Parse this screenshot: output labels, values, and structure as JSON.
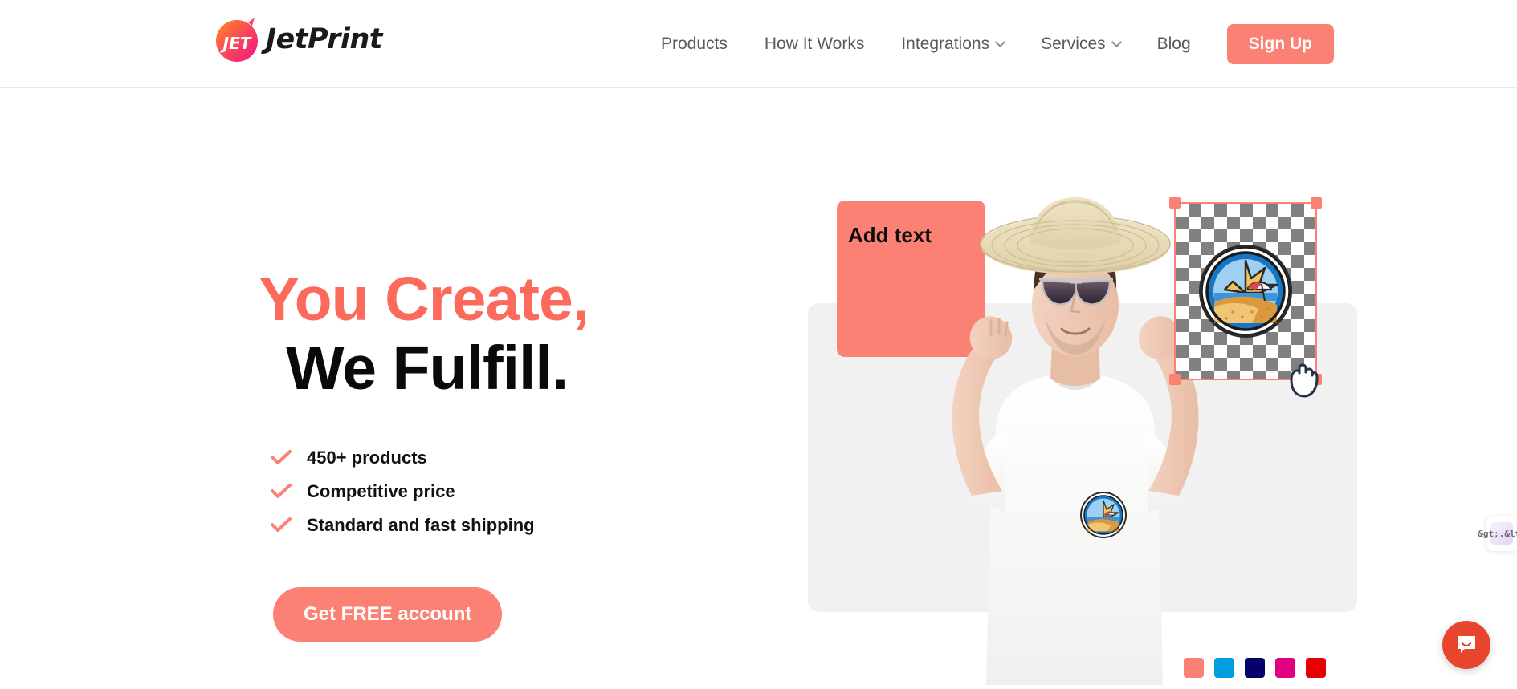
{
  "colors": {
    "accent": "#fb8175",
    "headline_accent": "#fc6a5c",
    "nav_text": "#5a5a5a",
    "panel_bg": "#f1f1f1",
    "intercom": "#e8452f"
  },
  "header": {
    "logo": {
      "mark_text": "JET",
      "wordmark": "JetPrint",
      "icon": "jetprint-logo-icon",
      "gradient_from": "#ff7a2f",
      "gradient_to": "#f0138c"
    },
    "nav": [
      {
        "label": "Products",
        "has_dropdown": false
      },
      {
        "label": "How It Works",
        "has_dropdown": false
      },
      {
        "label": "Integrations",
        "has_dropdown": true
      },
      {
        "label": "Services",
        "has_dropdown": true
      },
      {
        "label": "Blog",
        "has_dropdown": false
      }
    ],
    "signup_label": "Sign Up"
  },
  "hero": {
    "headline_line1": "You Create,",
    "headline_line2": "We Fulfill.",
    "bullets": [
      {
        "label": "450+ products",
        "icon": "check-icon"
      },
      {
        "label": "Competitive price",
        "icon": "check-icon"
      },
      {
        "label": "Standard and fast shipping",
        "icon": "check-icon"
      }
    ],
    "cta_label": "Get FREE account"
  },
  "mockup": {
    "add_text_label": "Add text",
    "design_badge": {
      "icon": "beach-sunset-badge-icon",
      "description": "Circular beach scene badge with sun, umbrella and dunes"
    },
    "model_photo": {
      "icon": "model-tshirt-photo",
      "description": "Man in straw hat and sunglasses wearing a white t-shirt with printed badge"
    },
    "selection": {
      "handles": 4,
      "cursor": "grab-hand-cursor"
    },
    "swatches": [
      {
        "name": "salmon",
        "hex": "#fb8175"
      },
      {
        "name": "blue",
        "hex": "#00a0e0"
      },
      {
        "name": "navy",
        "hex": "#06006b"
      },
      {
        "name": "magenta",
        "hex": "#e3007f"
      },
      {
        "name": "red",
        "hex": "#e60000"
      }
    ]
  },
  "widgets": {
    "side_tab_face": "&gt;.&lt;",
    "side_tab_icon": "kawaii-face-icon",
    "chat_icon": "intercom-chat-icon"
  }
}
